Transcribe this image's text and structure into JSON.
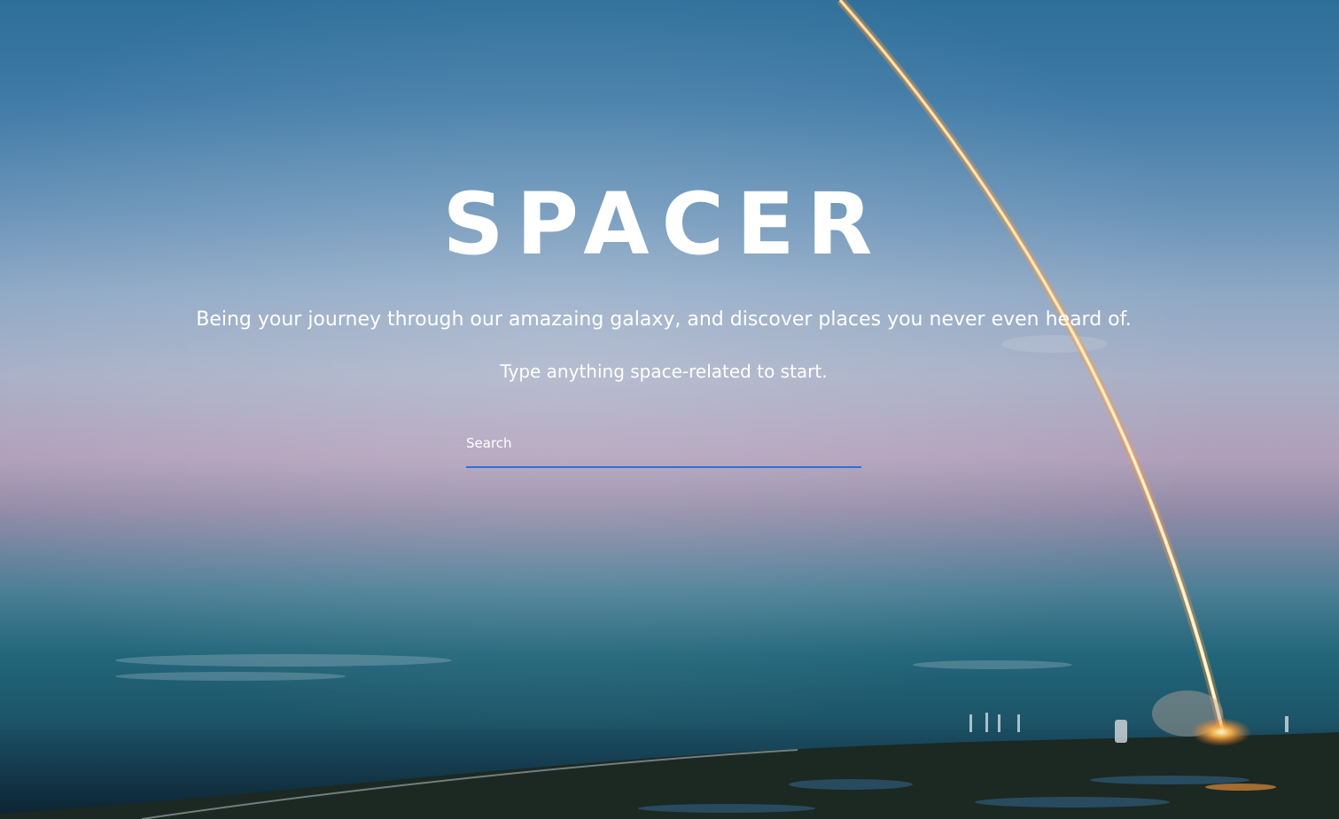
{
  "hero": {
    "title": "SPACER",
    "tagline": "Being your journey through our amazaing galaxy, and discover places you never even heard of.",
    "prompt": "Type anything space-related to start.",
    "background_image": "rocket-launch-streak-over-coastline"
  },
  "search": {
    "placeholder": "Search",
    "value": ""
  },
  "colors": {
    "text": "#ffffff",
    "search_underline": "#2f6fd6",
    "rocket_trail": "#ffd27a"
  }
}
